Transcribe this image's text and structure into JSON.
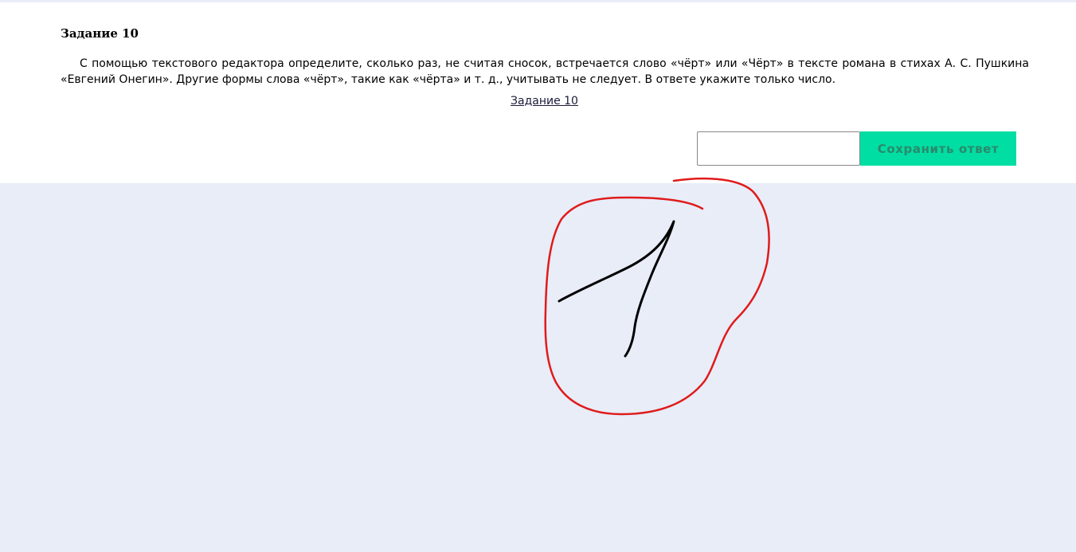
{
  "task": {
    "title": "Задание 10",
    "text": "С помощью текстового редактора определите, сколько раз, не считая сносок, встречается слово «чёрт» или «Чёрт» в тексте романа в стихах А. С. Пушкина «Евгений Онегин». Другие формы слова «чёрт», такие как «чёрта» и т. д., учитывать не следует. В ответе укажите только число.",
    "file_link": "Задание 10"
  },
  "answer": {
    "value": "",
    "save_label": "Сохранить ответ"
  },
  "colors": {
    "page_background": "#e8edf8",
    "card_background": "#ffffff",
    "save_button": "#00dea3",
    "annotation_circle": "#e01b1b",
    "annotation_digit": "#000000"
  }
}
